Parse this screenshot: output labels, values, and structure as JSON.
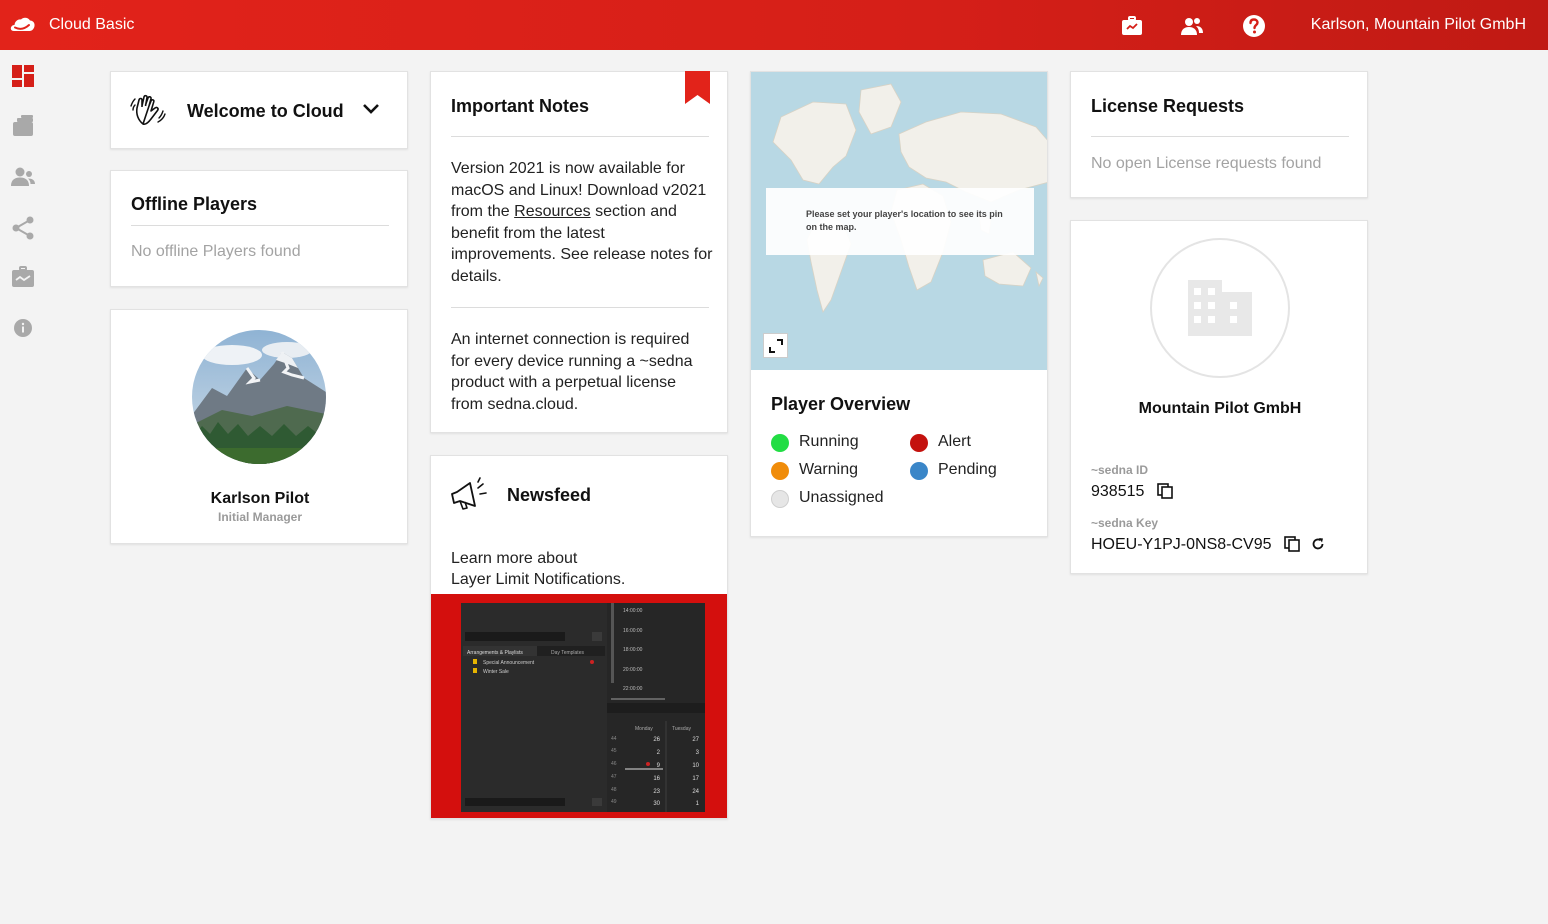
{
  "app": {
    "title": "Cloud Basic",
    "user": "Karlson, Mountain Pilot GmbH"
  },
  "topbar_icons": [
    "briefcase-icon",
    "users-icon",
    "help-icon"
  ],
  "sidebar": [
    "dashboard-icon",
    "media-icon",
    "users-icon",
    "share-icon",
    "toolbox-icon",
    "info-icon"
  ],
  "welcome": {
    "title": "Welcome to Cloud"
  },
  "offline": {
    "title": "Offline Players",
    "empty": "No offline Players found"
  },
  "profile": {
    "name": "Karlson Pilot",
    "role": "Initial Manager"
  },
  "notes": {
    "title": "Important Notes",
    "p1_pre": "Version 2021 is now available for macOS and Linux! Download v2021 from the ",
    "p1_link": "Resources",
    "p1_post": " section and benefit from the latest improvements. See release notes for details.",
    "p2": "An internet connection is required for every device running a ~sedna product with a perpetual license from sedna.cloud."
  },
  "newsfeed": {
    "title": "Newsfeed",
    "line1": "Learn more about",
    "line2": "Layer Limit Notifications.",
    "shot": {
      "tab1": "Arrangements & Playlists",
      "tab2": "Day Templates",
      "items": [
        "Special Announcement",
        "Winter Sale"
      ],
      "times": [
        "14:00:00",
        "16:00:00",
        "18:00:00",
        "20:00:00",
        "22:00:00"
      ],
      "days": [
        "Monday",
        "Tuesday"
      ],
      "weeks": [
        "44",
        "45",
        "46",
        "47",
        "48",
        "49"
      ],
      "mon": [
        "26",
        "2",
        "9",
        "16",
        "23",
        "30"
      ],
      "tue": [
        "27",
        "3",
        "10",
        "17",
        "24",
        "1"
      ]
    }
  },
  "map": {
    "message": "Please set your player's location to see its pin on the map."
  },
  "player": {
    "title": "Player Overview",
    "legend": [
      {
        "label": "Running",
        "color": "#22dd44"
      },
      {
        "label": "Alert",
        "color": "#c4120e"
      },
      {
        "label": "Warning",
        "color": "#f08c0a"
      },
      {
        "label": "Pending",
        "color": "#3a86c8"
      },
      {
        "label": "Unassigned",
        "color": "#e6e6e6"
      }
    ]
  },
  "license": {
    "title": "License Requests",
    "empty": "No open License requests found"
  },
  "company": {
    "name": "Mountain Pilot GmbH",
    "id_label": "~sedna ID",
    "id_value": "938515",
    "key_label": "~sedna Key",
    "key_value": "HOEU-Y1PJ-0NS8-CV95"
  },
  "colors": {
    "brand": "#e2231a",
    "muted": "#a3a3a3",
    "map_water": "#b8d8e4"
  }
}
